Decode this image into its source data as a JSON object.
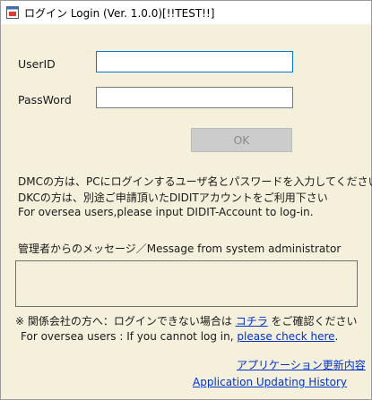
{
  "window": {
    "title": "ログイン Login (Ver. 1.0.0)[!!TEST!!]",
    "icon": "app-window-icon"
  },
  "form": {
    "userid_label": "UserID",
    "userid_value": "",
    "password_label": "PassWord",
    "password_value": "",
    "ok_label": "OK"
  },
  "info": {
    "line1": "DMCの方は、PCにログインするユーザ名とパスワードを入力してください",
    "line2": "DKCの方は、別途ご申請頂いたDIDITアカウントをご利用下さい",
    "line3": "For oversea users,please input DIDIT-Account to log-in."
  },
  "message": {
    "label": "管理者からのメッセージ／Message from system administrator",
    "text": ""
  },
  "notice": {
    "jp_prefix": "※ 関係会社の方へ：ログインできない場合は ",
    "jp_link": "コチラ",
    "jp_suffix": " をご確認ください",
    "en_prefix": "For oversea users : If you cannot log in, ",
    "en_link": "please check here",
    "en_suffix": "."
  },
  "links": {
    "history_jp": "アプリケーション更新内容",
    "history_en": "Application Updating History"
  },
  "colors": {
    "background": "#f5f0dc",
    "link": "#0033cc",
    "focus_border": "#0078d7"
  }
}
